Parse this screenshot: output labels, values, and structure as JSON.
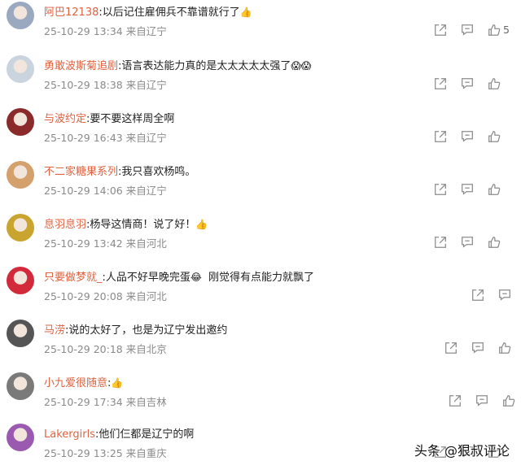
{
  "comments": [
    {
      "user": "阿巴12138",
      "text": "以后记住雇佣兵不靠谱就行了",
      "emoji": "👍",
      "date": "25-10-29 13:34",
      "location": "来自辽宁",
      "likes": "5",
      "avatar_color": "#9aa8c0"
    },
    {
      "user": "勇敢波斯菊追剧",
      "text": "语言表达能力真的是太太太太太强了",
      "emoji": "😱😱",
      "date": "25-10-29 18:38",
      "location": "来自辽宁",
      "likes": "",
      "avatar_color": "#c9d4de"
    },
    {
      "user": "与波约定",
      "text": "要不要这样周全啊",
      "emoji": "",
      "date": "25-10-29 16:43",
      "location": "来自辽宁",
      "likes": "",
      "avatar_color": "#8b2a2a"
    },
    {
      "user": "不二家糖果系列",
      "text": "我只喜欢杨鸣。",
      "emoji": "",
      "date": "25-10-29 14:06",
      "location": "来自辽宁",
      "likes": "",
      "avatar_color": "#d4a06b"
    },
    {
      "user": "息羽息羽",
      "text": "杨导这情商！说了好！",
      "emoji": "👍",
      "date": "25-10-29 13:42",
      "location": "来自河北",
      "likes": "",
      "avatar_color": "#c9a530"
    },
    {
      "user": "只要做梦就_",
      "text": "人品不好早晚完蛋",
      "emoji": "😂",
      "text2": "刚觉得有点能力就飘了",
      "date": "25-10-29 20:08",
      "location": "来自河北",
      "likes": "",
      "avatar_color": "#d22a3a"
    },
    {
      "user": "马涝",
      "text": "说的太好了，也是为辽宁发出邀约",
      "emoji": "",
      "date": "25-10-29 20:18",
      "location": "来自北京",
      "likes": "",
      "avatar_color": "#555555"
    },
    {
      "user": "小九爱很随意",
      "text": "",
      "emoji": "👍",
      "date": "25-10-29 17:34",
      "location": "来自吉林",
      "likes": "",
      "avatar_color": "#7a7a7a"
    },
    {
      "user": "Lakergirls",
      "text": "他们仨都是辽宁的啊",
      "emoji": "",
      "date": "25-10-29 13:25",
      "location": "来自重庆",
      "likes": "",
      "avatar_color": "#9a5ab0"
    }
  ],
  "watermark": "头条 @狠叔评论",
  "icons": {
    "share": "share-icon",
    "reply": "comment-icon",
    "like": "thumbs-up-icon"
  },
  "colors": {
    "username": "#e0623f",
    "meta": "#8a8a8a",
    "icon": "#8c8c8c"
  }
}
